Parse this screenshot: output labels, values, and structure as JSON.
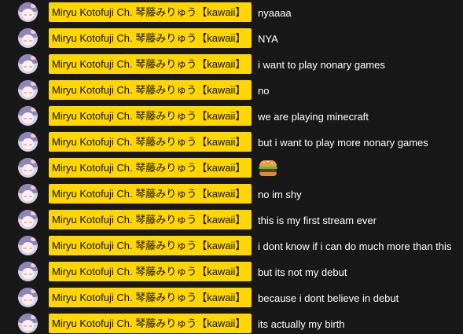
{
  "chat": {
    "author": "Miryu Kotofuji Ch. 琴藤みりゅう【kawaii】",
    "badge_color": "#ffd600",
    "background": "#181818",
    "messages": [
      {
        "text": "nyaaaa"
      },
      {
        "text": "NYA"
      },
      {
        "text": "i want to play nonary games"
      },
      {
        "text": "no"
      },
      {
        "text": "we are playing minecraft"
      },
      {
        "text": "but i want to play more nonary games"
      },
      {
        "text": "",
        "emoji": "hamburger-emoji"
      },
      {
        "text": "no im shy"
      },
      {
        "text": "this is my first stream ever"
      },
      {
        "text": "i dont know if i can do much more than this"
      },
      {
        "text": "but its not my debut"
      },
      {
        "text": "because i dont believe in debut"
      },
      {
        "text": "its actually my birth"
      }
    ]
  }
}
